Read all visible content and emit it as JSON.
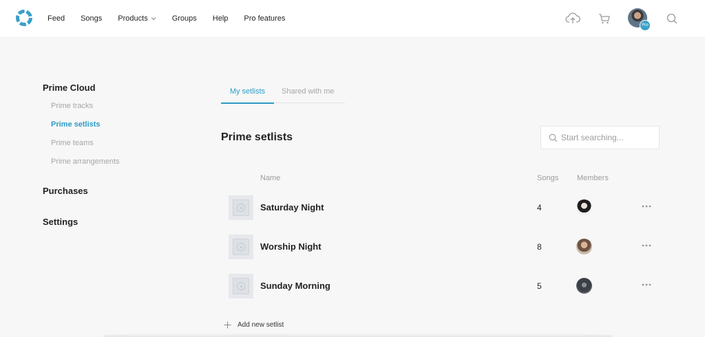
{
  "nav": {
    "items": [
      {
        "label": "Feed"
      },
      {
        "label": "Songs"
      },
      {
        "label": "Products",
        "has_dropdown": true
      },
      {
        "label": "Groups"
      },
      {
        "label": "Help"
      },
      {
        "label": "Pro features"
      }
    ],
    "icons": [
      "cloud-upload-icon",
      "cart-icon",
      "search-icon"
    ],
    "avatar_badge": "Pro"
  },
  "sidebar": {
    "sections": [
      {
        "title": "Prime Cloud",
        "items": [
          {
            "label": "Prime tracks",
            "active": false
          },
          {
            "label": "Prime setlists",
            "active": true
          },
          {
            "label": "Prime teams",
            "active": false
          },
          {
            "label": "Prime arrangements",
            "active": false
          }
        ]
      },
      {
        "title": "Purchases",
        "items": []
      },
      {
        "title": "Settings",
        "items": []
      }
    ]
  },
  "tabs": [
    {
      "label": "My setlists",
      "active": true
    },
    {
      "label": "Shared with me",
      "active": false
    }
  ],
  "main": {
    "title": "Prime setlists",
    "search_placeholder": "Start searching..."
  },
  "table": {
    "columns": {
      "name": "Name",
      "songs": "Songs",
      "members": "Members"
    },
    "rows": [
      {
        "name": "Saturday Night",
        "songs": "4"
      },
      {
        "name": "Worship Night",
        "songs": "8"
      },
      {
        "name": "Sunday Morning",
        "songs": "5"
      }
    ]
  },
  "add_new_label": "Add new setlist",
  "colors": {
    "accent": "#2f9bc6",
    "muted_text": "#a6a6a6",
    "background": "#f7f7f7"
  }
}
